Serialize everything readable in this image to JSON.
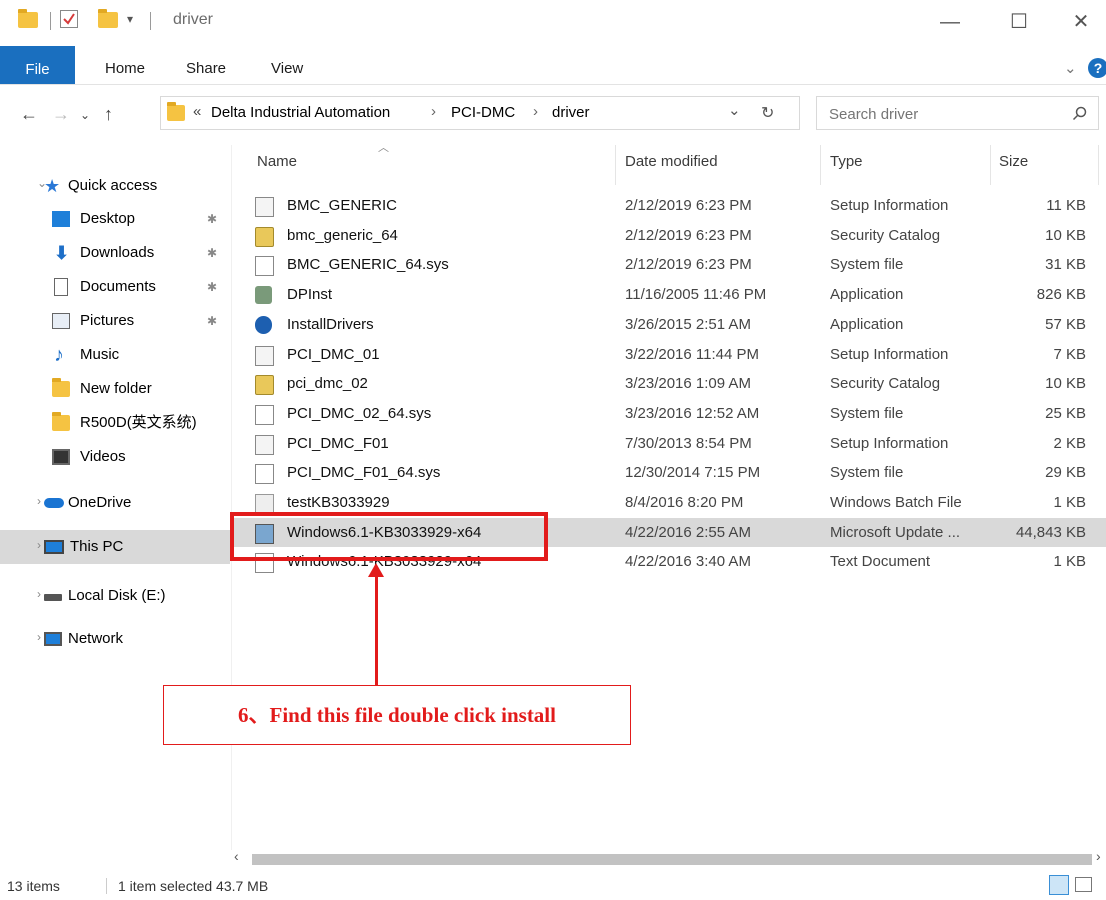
{
  "window": {
    "title": "driver",
    "controls": {
      "minimize": "—",
      "maximize": "☐",
      "close": "✕"
    }
  },
  "ribbon": {
    "tabs": [
      "File",
      "Home",
      "Share",
      "View"
    ],
    "help": "?",
    "chevron": "⌄"
  },
  "address": {
    "prefix": "«",
    "crumbs": [
      "Delta Industrial Automation",
      "PCI-DMC",
      "driver"
    ],
    "separator": "›",
    "search_placeholder": "Search driver"
  },
  "nav_pane": {
    "items": [
      {
        "label": "Quick access",
        "icon": "star-icon"
      },
      {
        "label": "Desktop",
        "icon": "desktop-icon",
        "pinned": true
      },
      {
        "label": "Downloads",
        "icon": "download-arrow-icon",
        "pinned": true
      },
      {
        "label": "Documents",
        "icon": "document-icon",
        "pinned": true
      },
      {
        "label": "Pictures",
        "icon": "pictures-icon",
        "pinned": true
      },
      {
        "label": "Music",
        "icon": "music-note-icon"
      },
      {
        "label": "New folder",
        "icon": "folder-icon"
      },
      {
        "label": "R500D(英文系统)",
        "icon": "folder-icon"
      },
      {
        "label": "Videos",
        "icon": "film-icon"
      },
      {
        "label": "OneDrive",
        "icon": "cloud-icon"
      },
      {
        "label": "This PC",
        "icon": "monitor-icon"
      },
      {
        "label": "Local Disk (E:)",
        "icon": "drive-icon"
      },
      {
        "label": "Network",
        "icon": "network-icon"
      }
    ]
  },
  "file_list": {
    "columns": [
      "Name",
      "Date modified",
      "Type",
      "Size"
    ],
    "rows": [
      {
        "name": "BMC_GENERIC",
        "date": "2/12/2019 6:23 PM",
        "type": "Setup Information",
        "size": "11 KB",
        "icon": "setup-info-icon"
      },
      {
        "name": "bmc_generic_64",
        "date": "2/12/2019 6:23 PM",
        "type": "Security Catalog",
        "size": "10 KB",
        "icon": "security-catalog-icon"
      },
      {
        "name": "BMC_GENERIC_64.sys",
        "date": "2/12/2019 6:23 PM",
        "type": "System file",
        "size": "31 KB",
        "icon": "system-file-icon"
      },
      {
        "name": "DPInst",
        "date": "11/16/2005 11:46 PM",
        "type": "Application",
        "size": "826 KB",
        "icon": "dpinst-app-icon"
      },
      {
        "name": "InstallDrivers",
        "date": "3/26/2015 2:51 AM",
        "type": "Application",
        "size": "57 KB",
        "icon": "install-app-icon"
      },
      {
        "name": "PCI_DMC_01",
        "date": "3/22/2016 11:44 PM",
        "type": "Setup Information",
        "size": "7 KB",
        "icon": "setup-info-icon"
      },
      {
        "name": "pci_dmc_02",
        "date": "3/23/2016 1:09 AM",
        "type": "Security Catalog",
        "size": "10 KB",
        "icon": "security-catalog-icon"
      },
      {
        "name": "PCI_DMC_02_64.sys",
        "date": "3/23/2016 12:52 AM",
        "type": "System file",
        "size": "25 KB",
        "icon": "system-file-icon"
      },
      {
        "name": "PCI_DMC_F01",
        "date": "7/30/2013 8:54 PM",
        "type": "Setup Information",
        "size": "2 KB",
        "icon": "setup-info-icon"
      },
      {
        "name": "PCI_DMC_F01_64.sys",
        "date": "12/30/2014 7:15 PM",
        "type": "System file",
        "size": "29 KB",
        "icon": "system-file-icon"
      },
      {
        "name": "testKB3033929",
        "date": "8/4/2016 8:20 PM",
        "type": "Windows Batch File",
        "size": "1 KB",
        "icon": "batch-file-icon"
      },
      {
        "name": "Windows6.1-KB3033929-x64",
        "date": "4/22/2016 2:55 AM",
        "type": "Microsoft Update ...",
        "size": "44,843 KB",
        "icon": "msu-package-icon",
        "selected": true
      },
      {
        "name": "Windows6.1-KB3033929-x64",
        "date": "4/22/2016 3:40 AM",
        "type": "Text Document",
        "size": "1 KB",
        "icon": "text-document-icon"
      }
    ]
  },
  "annotation": {
    "text": "6、Find this file double click install",
    "color": "#e21b1b"
  },
  "status_bar": {
    "items": "13 items",
    "selection": "1 item selected 43.7 MB"
  },
  "colors": {
    "file_tab": "#1a6fbf",
    "selected_row": "#d9d9d9",
    "accent_red": "#e21b1b"
  }
}
